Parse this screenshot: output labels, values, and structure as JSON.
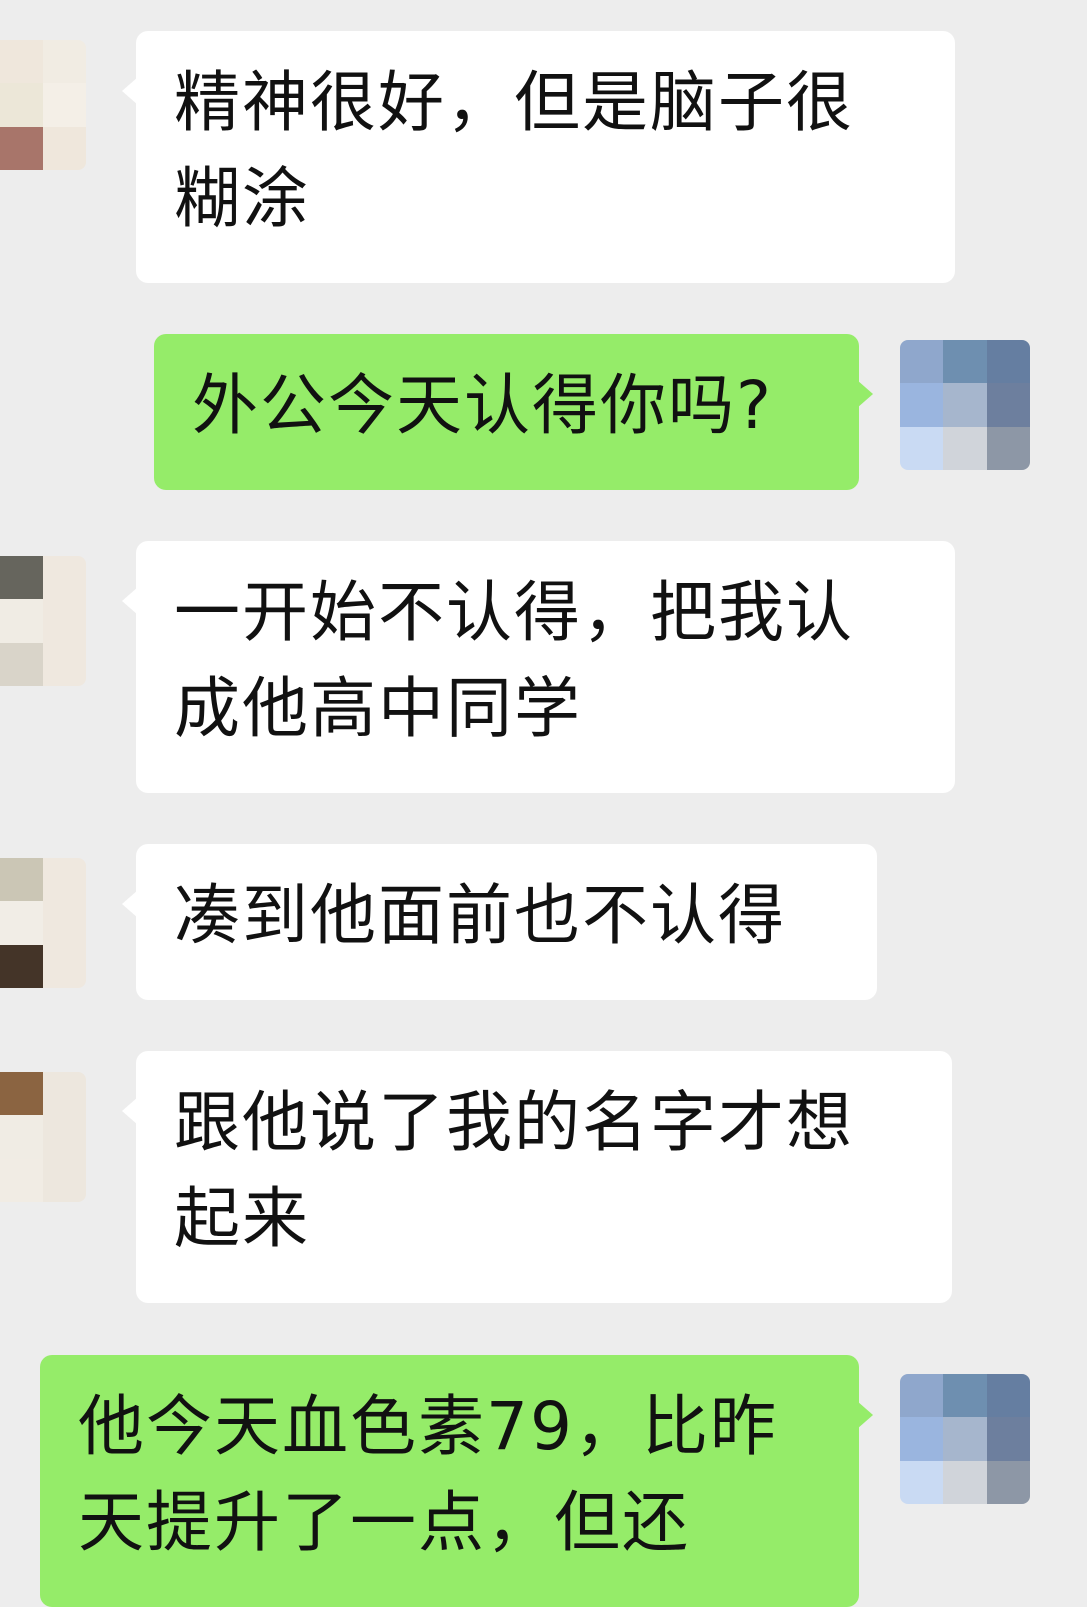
{
  "colors": {
    "background": "#ededed",
    "incoming_bubble": "#ffffff",
    "outgoing_bubble": "#95ec69",
    "text": "#111111"
  },
  "avatars": {
    "contact_1": [
      "#d98c7f",
      "#efe7dc",
      "#f1ece3",
      "#efe7dc",
      "#ece7d8",
      "#f4efe7",
      "#d49a62",
      "#a8756a",
      "#efe7dc"
    ],
    "self": [
      "#8fa7cc",
      "#6e8fb0",
      "#657ea1",
      "#9ab5df",
      "#a6b6cd",
      "#6d7f9e",
      "#c9daf3",
      "#d0d4da",
      "#8d97a6"
    ],
    "contact_2": [
      "#6f6a61",
      "#66655d",
      "#efe8df",
      "#ede8dd",
      "#f0ece4",
      "#efe8df",
      "#141313",
      "#d9d4c9",
      "#efe8df"
    ],
    "contact_3": [
      "#b68a80",
      "#cbc6b5",
      "#efe8df",
      "#eee6da",
      "#f1ede6",
      "#efe8df",
      "#36291f",
      "#443428",
      "#efe8df"
    ],
    "contact_4": [
      "#f0ebe2",
      "#8b6441",
      "#ede7de",
      "#0f0f0e",
      "#f0ece4",
      "#ede7de",
      "#f2eee8",
      "#f1ece4",
      "#ede7de"
    ]
  },
  "messages": [
    {
      "text": "精神很好，但是脑子很糊涂"
    },
    {
      "text": "外公今天认得你吗?"
    },
    {
      "text": "一开始不认得，把我认成他高中同学"
    },
    {
      "text": "凑到他面前也不认得"
    },
    {
      "text": "跟他说了我的名字才想起来"
    },
    {
      "text": "他今天血色素79，比昨天提升了一点，但还"
    }
  ]
}
